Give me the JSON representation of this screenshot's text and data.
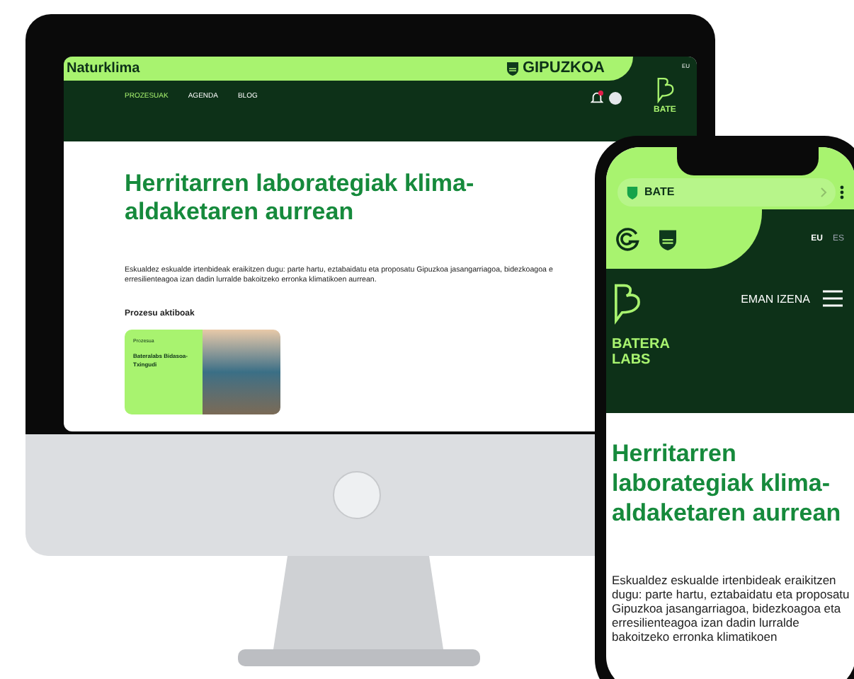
{
  "monitor": {
    "brand": "Naturklima",
    "partner": "GIPUZKOA",
    "nav": [
      {
        "label": "PROZESUAK",
        "selected": true
      },
      {
        "label": "AGENDA",
        "selected": false
      },
      {
        "label": "BLOG",
        "selected": false
      }
    ],
    "language": "EU",
    "side_logo": "BATE",
    "title": "Herritarren laborategiak klima-aldaketaren aurrean",
    "description": "Eskualdez eskualde irtenbideak eraikitzen dugu: parte hartu, eztabaidatu eta proposatu Gipuzkoa jasangarriagoa, bidezkoagoa e erresilienteagoa izan dadin lurralde bakoitzeko erronka klimatikoen aurrean.",
    "section_title": "Prozesu aktiboak",
    "cards": [
      {
        "tag": "Prozesua",
        "title": "Bateralabs Bidasoa-Txingudi"
      }
    ]
  },
  "phone": {
    "url": "BATE",
    "languages": [
      {
        "label": "EU",
        "selected": true
      },
      {
        "label": "ES",
        "selected": false
      }
    ],
    "logo": "BATERA LABS",
    "cta": "EMAN IZENA",
    "title": "Herritarren laborategiak klima-aldaketaren aurrean",
    "description": "Eskualdez eskualde irtenbideak eraikitzen dugu: parte hartu, eztabaidatu eta proposatu Gipuzkoa jasangarriagoa, bidezkoagoa eta erresilienteagoa izan dadin lurralde bakoitzeko erronka klimatikoen"
  }
}
